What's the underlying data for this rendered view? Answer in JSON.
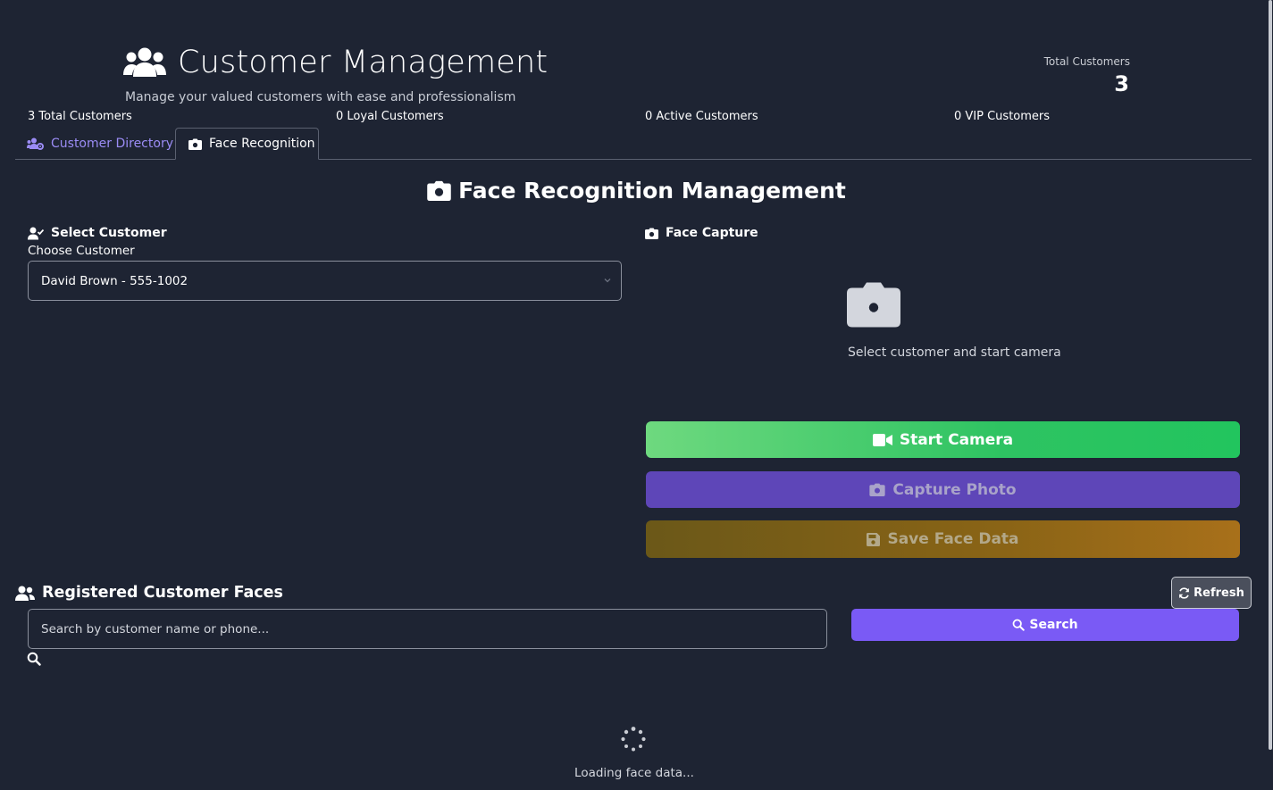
{
  "header": {
    "title": "Customer Management",
    "subtitle": "Manage your valued customers with ease and professionalism",
    "total_label": "Total Customers",
    "total_value": "3",
    "icon": "users-icon"
  },
  "stats": [
    {
      "label": "3 Total Customers"
    },
    {
      "label": "0 Loyal Customers"
    },
    {
      "label": "0 Active Customers"
    },
    {
      "label": "0 VIP Customers"
    }
  ],
  "tabs": [
    {
      "label": "Customer Directory",
      "icon": "users-cog-icon",
      "active": false
    },
    {
      "label": "Face Recognition",
      "icon": "camera-icon",
      "active": true
    }
  ],
  "section": {
    "title": "Face Recognition Management"
  },
  "select_panel": {
    "title": "Select Customer",
    "choose_label": "Choose Customer",
    "selected_value": "David Brown - 555-1002"
  },
  "capture_panel": {
    "title": "Face Capture",
    "placeholder_text": "Select customer and start camera",
    "start_label": "Start Camera",
    "capture_label": "Capture Photo",
    "save_label": "Save Face Data"
  },
  "registered": {
    "title": "Registered Customer Faces",
    "refresh_label": "Refresh",
    "search_placeholder": "Search by customer name or phone...",
    "search_label": "Search",
    "loading_text": "Loading face data..."
  },
  "colors": {
    "background": "#1e2433",
    "accent": "#7a5af5",
    "success": "#22c55e",
    "tab_link": "#9b8cf5"
  }
}
